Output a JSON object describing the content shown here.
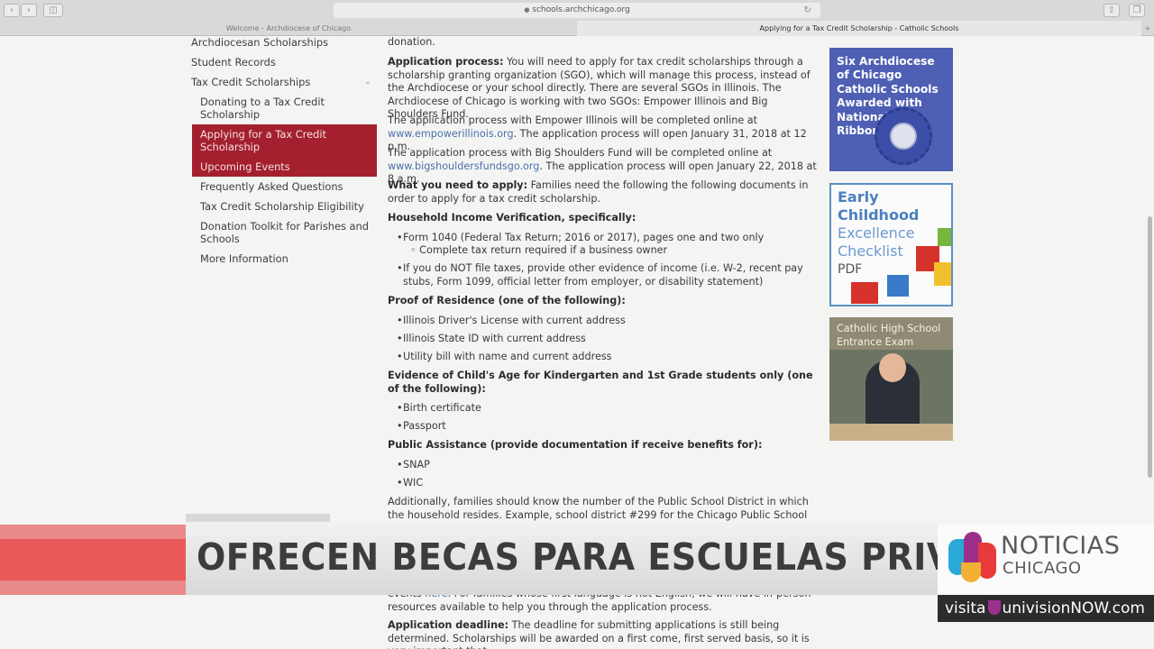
{
  "browser": {
    "url": "schools.archchicago.org",
    "tabs": [
      "Welcome - Archdiocese of Chicago",
      "Applying for a Tax Credit Scholarship - Catholic Schools"
    ],
    "back_icon": "chevron-left-icon",
    "forward_icon": "chevron-right-icon"
  },
  "sidebar": {
    "items": [
      {
        "label": "Archdiocesan Scholarships"
      },
      {
        "label": "Student Records"
      },
      {
        "label": "Tax Credit Scholarships"
      }
    ],
    "subitems": [
      {
        "label": "Donating to a Tax Credit Scholarship"
      },
      {
        "label": "Applying for a Tax Credit Scholarship"
      },
      {
        "label": "Upcoming Events"
      },
      {
        "label": "Frequently Asked Questions"
      },
      {
        "label": "Tax Credit Scholarship Eligibility"
      },
      {
        "label": "Donation Toolkit for Parishes and Schools"
      },
      {
        "label": "More Information"
      }
    ],
    "highlight_color": "#a4202e"
  },
  "main": {
    "donation_tail": "donation.",
    "app_process_label": "Application process:",
    "app_process_text": " You will need to apply for tax credit scholarships through a scholarship granting organization (SGO), which will manage this process, instead of the Archdiocese or your school directly. There are several SGOs in Illinois. The Archdiocese of Chicago is working with two SGOs: Empower Illinois and Big Shoulders Fund.",
    "empower_pre": "The application process with Empower Illinois will be completed online at ",
    "empower_link": "www.empowerillinois.org",
    "empower_post": ". The application process will open January 31, 2018 at 12 p.m.",
    "bsf_pre": "The application process with Big Shoulders Fund will be completed online at ",
    "bsf_link": "www.bigshouldersfundsgo.org",
    "bsf_post": ". The application process will open January 22, 2018 at 8 a.m.",
    "need_label": "What you need to apply:",
    "need_text": " Families need the following the following documents in order to apply for a tax credit scholarship.",
    "income_heading": "Household Income Verification, specifically:",
    "income_items": [
      "Form 1040 (Federal Tax Return; 2016 or 2017), pages one and two only",
      "If you do NOT file taxes, provide other evidence of income (i.e. W-2, recent pay stubs, Form 1099, official letter from employer, or disability statement)"
    ],
    "income_subitem": "Complete tax return required if a business owner",
    "residence_heading": "Proof of Residence (one of the following):",
    "residence_items": [
      "Illinois Driver's License with current address",
      "Illinois State ID with current address",
      "Utility bill with name and current address"
    ],
    "age_heading": "Evidence of Child's Age for Kindergarten and 1st Grade students only (one of the following):",
    "age_items": [
      "Birth certificate",
      "Passport"
    ],
    "assist_heading": "Public Assistance (provide documentation if receive benefits for):",
    "assist_items": [
      "SNAP",
      "WIC"
    ],
    "additionally": "Additionally, families should know the number of the Public School District in which the household resides. Example, school district #299 for the Chicago Public School System.",
    "events_pre": "events ",
    "events_link": "here",
    "events_post": ". For families whose first language is not English, we will have in-person resources available to help you through the application process.",
    "deadline_label": "Application deadline:",
    "deadline_text": " The deadline for submitting applications is still being determined. Scholarships will be awarded on a first come, first served basis, so it is very important that"
  },
  "ads": {
    "blue_ribbon": "Six Archdiocese of Chicago Catholic Schools Awarded with National Blue Ribbons",
    "early_l1": "Early Childhood",
    "early_l2": "Excellence Checklist",
    "early_l3": "PDF",
    "exam": "Catholic High School Entrance Exam"
  },
  "broadcast": {
    "headline": "OFRECEN BECAS PARA ESCUELAS PRIVADAS",
    "logo_line1": "NOTICIAS",
    "logo_line2": "CHICAGO",
    "visita_pre": "visita",
    "visita_brand": "univisionNOW.com"
  }
}
